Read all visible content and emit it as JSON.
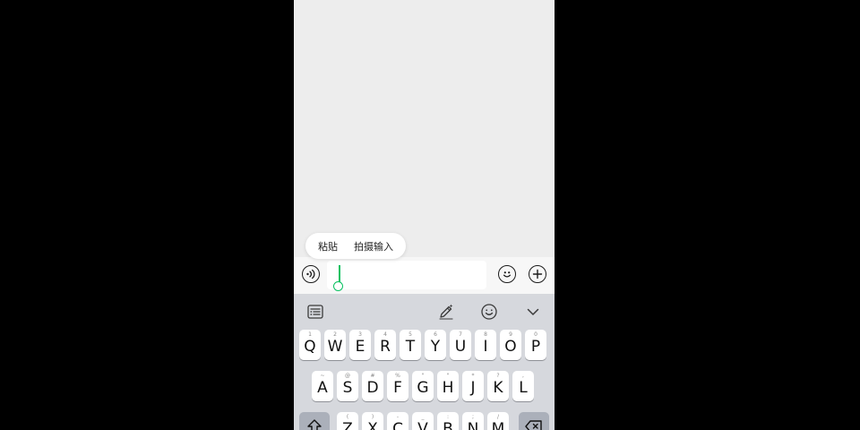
{
  "popup_menu": {
    "paste_label": "粘贴",
    "photo_input_label": "拍摄输入"
  },
  "colors": {
    "accent_green": "#07c160",
    "chat_background": "#ededed",
    "keyboard_background": "#d6d8dd"
  },
  "input_bar": {
    "left_icon": "voice-icon",
    "right_icons": [
      "emoji-icon",
      "plus-icon"
    ]
  },
  "keyboard_toolbar": {
    "icons": [
      "text-list-icon",
      "handwriting-icon",
      "emoji-smile-icon",
      "collapse-chevron-icon"
    ]
  },
  "keyboard": {
    "row1": [
      {
        "letter": "Q",
        "hint": "1"
      },
      {
        "letter": "W",
        "hint": "2"
      },
      {
        "letter": "E",
        "hint": "3"
      },
      {
        "letter": "R",
        "hint": "4"
      },
      {
        "letter": "T",
        "hint": "5"
      },
      {
        "letter": "Y",
        "hint": "6"
      },
      {
        "letter": "U",
        "hint": "7"
      },
      {
        "letter": "I",
        "hint": "8"
      },
      {
        "letter": "O",
        "hint": "9"
      },
      {
        "letter": "P",
        "hint": "0"
      }
    ],
    "row2": [
      {
        "letter": "A",
        "hint": "~"
      },
      {
        "letter": "S",
        "hint": "@"
      },
      {
        "letter": "D",
        "hint": "#"
      },
      {
        "letter": "F",
        "hint": "%"
      },
      {
        "letter": "G",
        "hint": "\""
      },
      {
        "letter": "H",
        "hint": "\""
      },
      {
        "letter": "J",
        "hint": "*"
      },
      {
        "letter": "K",
        "hint": "?"
      },
      {
        "letter": "L",
        "hint": ","
      }
    ],
    "row3": [
      {
        "letter": "Z",
        "hint": "("
      },
      {
        "letter": "X",
        "hint": ")"
      },
      {
        "letter": "C",
        "hint": "-"
      },
      {
        "letter": "V",
        "hint": "_"
      },
      {
        "letter": "B",
        "hint": ":"
      },
      {
        "letter": "N",
        "hint": ";"
      },
      {
        "letter": "M",
        "hint": "/"
      }
    ],
    "shift_icon": "shift-icon",
    "backspace_icon": "backspace-icon"
  }
}
